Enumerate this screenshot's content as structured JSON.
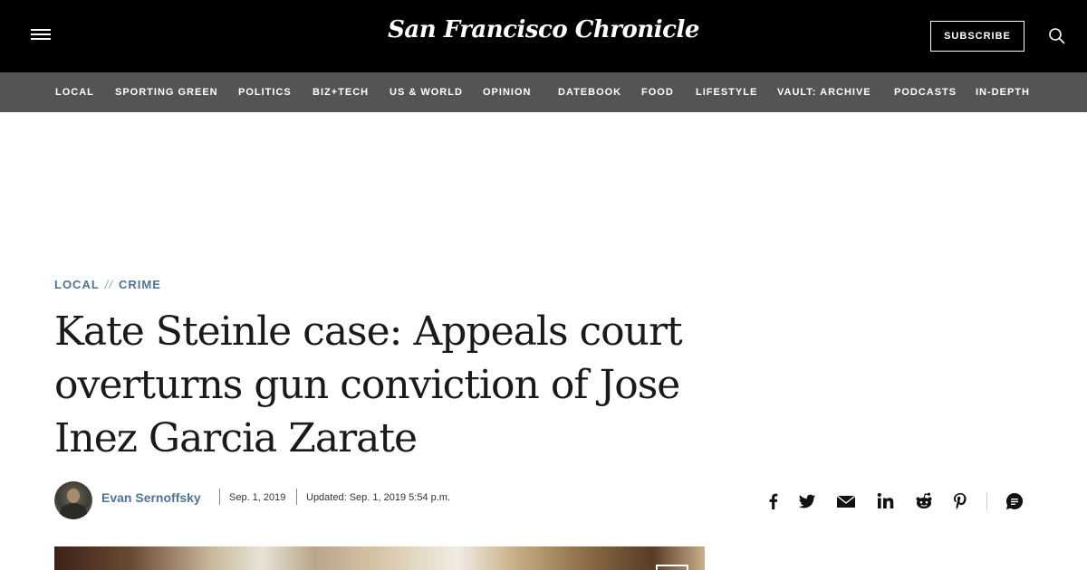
{
  "header": {
    "logo_text": "San Francisco Chronicle",
    "subscribe_label": "SUBSCRIBE"
  },
  "nav": {
    "items": [
      {
        "label": "LOCAL"
      },
      {
        "label": "SPORTING GREEN"
      },
      {
        "label": "POLITICS"
      },
      {
        "label": "BIZ+TECH"
      },
      {
        "label": "US & WORLD"
      },
      {
        "label": "OPINION"
      },
      {
        "label": "DATEBOOK"
      },
      {
        "label": "FOOD"
      },
      {
        "label": "LIFESTYLE"
      },
      {
        "label": "VAULT: ARCHIVE"
      },
      {
        "label": "PODCASTS"
      },
      {
        "label": "IN-DEPTH"
      }
    ]
  },
  "article": {
    "breadcrumb": {
      "section": "LOCAL",
      "separator": "//",
      "subsection": "CRIME"
    },
    "headline": "Kate Steinle case: Appeals court overturns gun conviction of Jose Inez Garcia Zarate",
    "byline": {
      "author": "Evan Sernoffsky",
      "published": "Sep. 1, 2019",
      "updated": "Updated: Sep. 1, 2019 5:54 p.m."
    }
  },
  "share": {
    "icons": [
      "facebook-icon",
      "twitter-icon",
      "email-icon",
      "linkedin-icon",
      "reddit-icon",
      "pinterest-icon",
      "comments-icon"
    ]
  },
  "colors": {
    "header_bg": "#000000",
    "nav_bg": "#545454",
    "accent_link": "#4e7398",
    "headline_text": "#1a1a1a"
  }
}
